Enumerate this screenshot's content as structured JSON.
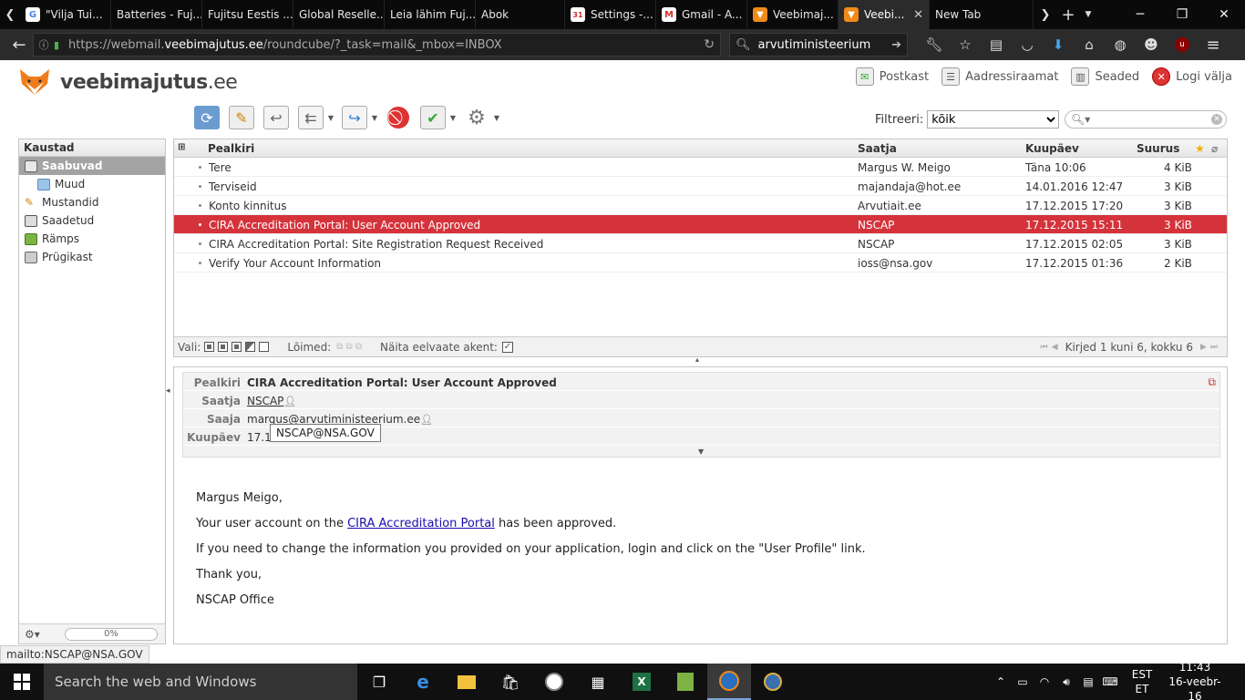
{
  "browser": {
    "tabs": [
      {
        "label": "\"Vilja Tui...",
        "icon": "google-icon",
        "active": false
      },
      {
        "label": "Batteries - Fuj...",
        "icon": "",
        "active": false
      },
      {
        "label": "Fujitsu Eestis ...",
        "icon": "",
        "active": false
      },
      {
        "label": "Global Reselle...",
        "icon": "",
        "active": false
      },
      {
        "label": "Leia lähim Fuj...",
        "icon": "",
        "active": false
      },
      {
        "label": "Abok",
        "icon": "",
        "active": false
      },
      {
        "label": "Settings -...",
        "icon": "calendar-icon",
        "active": false
      },
      {
        "label": "Gmail - A...",
        "icon": "gmail-icon",
        "active": false
      },
      {
        "label": "Veebimaj...",
        "icon": "fox-icon",
        "active": false
      },
      {
        "label": "Veebi...",
        "icon": "fox-icon",
        "active": true
      },
      {
        "label": "New Tab",
        "icon": "",
        "active": false
      }
    ],
    "url_prefix": "https://webmail.",
    "url_domain": "veebimajutus.ee",
    "url_rest": "/roundcube/?_task=mail&_mbox=INBOX",
    "search_value": "arvutiministeerium"
  },
  "app": {
    "logo_bold": "veebimajutus",
    "logo_suffix": ".ee",
    "topnav": [
      {
        "label": "Postkast",
        "icon": "inbox-icon"
      },
      {
        "label": "Aadressiraamat",
        "icon": "addressbook-icon"
      },
      {
        "label": "Seaded",
        "icon": "settings-icon"
      },
      {
        "label": "Logi välja",
        "icon": "logout-icon"
      }
    ],
    "filter_label": "Filtreeri:",
    "filter_value": "kõik"
  },
  "folders": {
    "header": "Kaustad",
    "items": [
      {
        "label": "Saabuvad",
        "icon": "inbox-icon",
        "selected": true,
        "sub": false
      },
      {
        "label": "Muud",
        "icon": "folder-icon",
        "selected": false,
        "sub": true
      },
      {
        "label": "Mustandid",
        "icon": "drafts-icon",
        "selected": false,
        "sub": false
      },
      {
        "label": "Saadetud",
        "icon": "sent-icon",
        "selected": false,
        "sub": false
      },
      {
        "label": "Rämps",
        "icon": "junk-icon",
        "selected": false,
        "sub": false
      },
      {
        "label": "Prügikast",
        "icon": "trash-icon",
        "selected": false,
        "sub": false
      }
    ],
    "quota": "0%"
  },
  "list": {
    "columns": {
      "subject": "Pealkiri",
      "from": "Saatja",
      "date": "Kuupäev",
      "size": "Suurus"
    },
    "rows": [
      {
        "subject": "Tere",
        "from": "Margus W. Meigo",
        "date": "Täna 10:06",
        "size": "4 KiB",
        "selected": false
      },
      {
        "subject": "Terviseid",
        "from": "majandaja@hot.ee",
        "date": "14.01.2016 12:47",
        "size": "3 KiB",
        "selected": false
      },
      {
        "subject": "Konto kinnitus",
        "from": "Arvutiait.ee",
        "date": "17.12.2015 17:20",
        "size": "3 KiB",
        "selected": false
      },
      {
        "subject": "CIRA Accreditation Portal: User Account Approved",
        "from": "NSCAP",
        "date": "17.12.2015 15:11",
        "size": "3 KiB",
        "selected": true
      },
      {
        "subject": "CIRA Accreditation Portal: Site Registration Request Received",
        "from": "NSCAP",
        "date": "17.12.2015 02:05",
        "size": "3 KiB",
        "selected": false
      },
      {
        "subject": "Verify Your Account Information",
        "from": "ioss@nsa.gov",
        "date": "17.12.2015 01:36",
        "size": "2 KiB",
        "selected": false
      }
    ],
    "footer": {
      "select_label": "Vali:",
      "threads_label": "Lõimed:",
      "preview_label": "Näita eelvaate akent:",
      "count": "Kirjed 1 kuni 6, kokku 6"
    }
  },
  "preview": {
    "headers": [
      {
        "key": "Pealkiri",
        "value": "CIRA Accreditation Portal: User Account Approved"
      },
      {
        "key": "Saatja",
        "value": "NSCAP"
      },
      {
        "key": "Saaja",
        "value": "margus@arvutiministeerium.ee"
      },
      {
        "key": "Kuupäev",
        "value": "17.1"
      }
    ],
    "tooltip": "NSCAP@NSA.GOV",
    "body": {
      "greeting": "Margus Meigo,",
      "line1_pre": "Your user account on the ",
      "line1_link": "CIRA Accreditation Portal",
      "line1_post": " has been approved.",
      "line2": "If you need to change the information you provided on your application, login and click on the \"User Profile\" link.",
      "line3": "Thank you,",
      "line4": "NSCAP Office"
    }
  },
  "status_text": "mailto:NSCAP@NSA.GOV",
  "taskbar": {
    "search_placeholder": "Search the web and Windows",
    "lang_top": "EST",
    "lang_bottom": "ET",
    "time": "11:43",
    "date": "16-veebr-16"
  }
}
